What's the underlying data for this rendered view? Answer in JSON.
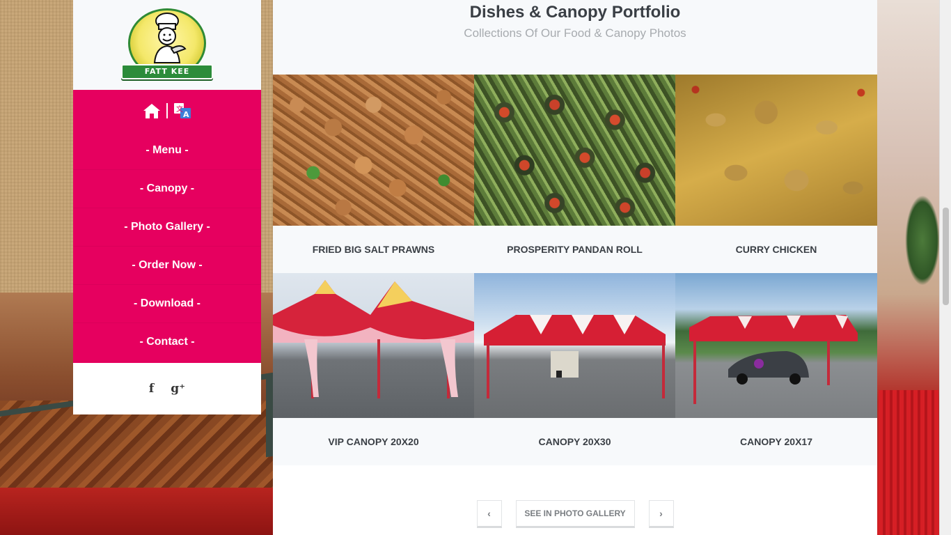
{
  "brand": {
    "logo_text": "FATT KEE"
  },
  "nav": {
    "items": [
      {
        "label": "- Menu -"
      },
      {
        "label": "- Canopy -"
      },
      {
        "label": "- Photo Gallery -"
      },
      {
        "label": "- Order Now -"
      },
      {
        "label": "- Download -"
      },
      {
        "label": "- Contact -"
      }
    ],
    "icons": [
      "home-icon",
      "translate-icon"
    ]
  },
  "social": {
    "facebook": "f",
    "googleplus": "g⁺"
  },
  "portfolio": {
    "title": "Dishes & Canopy Portfolio",
    "subtitle": "Collections Of Our Food & Canopy Photos",
    "items": [
      {
        "caption": "FRIED BIG SALT PRAWNS"
      },
      {
        "caption": "PROSPERITY PANDAN ROLL"
      },
      {
        "caption": "CURRY CHICKEN"
      },
      {
        "caption": "VIP CANOPY 20X20"
      },
      {
        "caption": "CANOPY 20X30"
      },
      {
        "caption": "CANOPY 20X17"
      }
    ]
  },
  "pager": {
    "prev": "‹",
    "gallery": "SEE IN PHOTO GALLERY",
    "next": "›"
  },
  "colors": {
    "accent": "#e6005f",
    "heading": "#3a3f45",
    "subheading": "#a7abaf"
  }
}
